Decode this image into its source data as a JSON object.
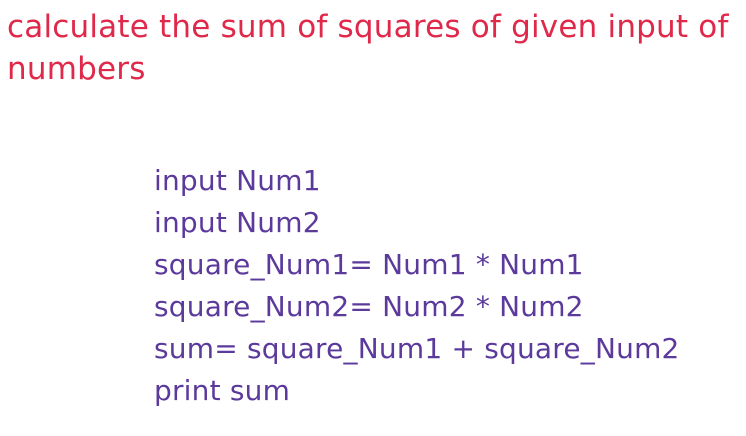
{
  "document": {
    "title": "calculate the sum of squares of given input of numbers",
    "code_lines": [
      "input Num1",
      "input Num2",
      "square_Num1= Num1 * Num1",
      "square_Num2= Num2 * Num2",
      "sum= square_Num1 + square_Num2",
      "print sum"
    ]
  },
  "colors": {
    "title": "#e0294a",
    "code": "#5b3a9c",
    "background": "#ffffff"
  }
}
